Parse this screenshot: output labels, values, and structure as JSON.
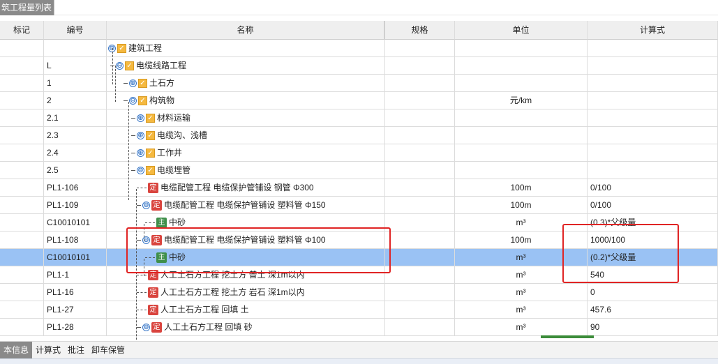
{
  "window": {
    "title": "筑工程量列表"
  },
  "columns": {
    "mark": "标记",
    "code": "编号",
    "name": "名称",
    "spec": "规格",
    "unit": "单位",
    "formula": "计算式"
  },
  "rows": [
    {
      "code": "",
      "name": "建筑工程",
      "unit": "",
      "formula": ""
    },
    {
      "code": "L",
      "name": "电缆线路工程",
      "unit": "",
      "formula": ""
    },
    {
      "code": "1",
      "name": "土石方",
      "unit": "",
      "formula": ""
    },
    {
      "code": "2",
      "name": "构筑物",
      "unit": "元/km",
      "formula": ""
    },
    {
      "code": "2.1",
      "name": "材料运输",
      "unit": "",
      "formula": ""
    },
    {
      "code": "2.3",
      "name": "电缆沟、浅槽",
      "unit": "",
      "formula": ""
    },
    {
      "code": "2.4",
      "name": "工作井",
      "unit": "",
      "formula": ""
    },
    {
      "code": "2.5",
      "name": "电缆埋管",
      "unit": "",
      "formula": ""
    },
    {
      "code": "PL1-106",
      "name": "电缆配管工程 电缆保护管铺设 钢管 Φ300",
      "unit": "100m",
      "formula": "0/100"
    },
    {
      "code": "PL1-109",
      "name": "电缆配管工程 电缆保护管铺设 塑料管 Φ150",
      "unit": "100m",
      "formula": "0/100"
    },
    {
      "code": "C10010101",
      "name": "中砂",
      "unit": "m³",
      "formula": "(0.3)*父级量"
    },
    {
      "code": "PL1-108",
      "name": "电缆配管工程 电缆保护管铺设 塑料管 Φ100",
      "unit": "100m",
      "formula": "1000/100"
    },
    {
      "code": "C10010101",
      "name": "中砂",
      "unit": "m³",
      "formula": "(0.2)*父级量"
    },
    {
      "code": "PL1-1",
      "name": "人工土石方工程 挖土方 普土 深1m以内",
      "unit": "m³",
      "formula": "540"
    },
    {
      "code": "PL1-16",
      "name": "人工土石方工程 挖土方 岩石 深1m以内",
      "unit": "m³",
      "formula": "0"
    },
    {
      "code": "PL1-27",
      "name": "人工土石方工程 回填 土",
      "unit": "m³",
      "formula": "457.6"
    },
    {
      "code": "PL1-28",
      "name": "人工土石方工程 回填 砂",
      "unit": "m³",
      "formula": "90"
    }
  ],
  "icons": {
    "collapse": "⊖",
    "expand": "⊕",
    "check": "✓",
    "quota_badge": "定",
    "material_badge": "主"
  },
  "bottom_tabs": [
    "本信息",
    "计算式",
    "批注",
    "卸车保管"
  ],
  "colors": {
    "selected_row": "#9ac2f4",
    "highlight_box": "#e02424",
    "quota_badge": "#d9443e",
    "material_badge": "#3f8f4a",
    "folder_check": "#f5b940"
  }
}
